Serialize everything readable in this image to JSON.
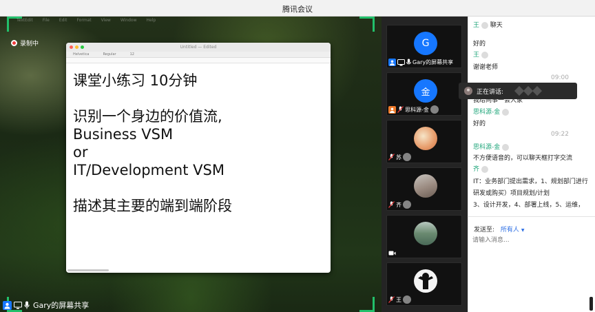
{
  "window": {
    "title": "腾讯会议"
  },
  "recording": {
    "label": "录制中"
  },
  "mac": {
    "menu": [
      "TextEdit",
      "File",
      "Edit",
      "Format",
      "View",
      "Window",
      "Help"
    ]
  },
  "editor": {
    "title": "Untitled — Edited",
    "font": "Helvetica",
    "style": "Regular",
    "size": "12",
    "lines": [
      "课堂小练习 10分钟",
      "",
      "识别一个身边的价值流,",
      "Business VSM",
      "or",
      "IT/Development VSM",
      "",
      "描述其主要的端到端阶段"
    ]
  },
  "share_bar": {
    "label": "Gary的屏幕共享"
  },
  "gallery": [
    {
      "avatar_letter": "G",
      "avatar_color": "#1677ff",
      "label": "Gary的屏幕共享"
    },
    {
      "avatar_letter": "金",
      "avatar_color": "#1677ff",
      "label": "思科源-金"
    },
    {
      "avatar_letter": "",
      "avatar_color": "#e8a070",
      "label": "苏"
    },
    {
      "avatar_letter": "",
      "avatar_color": "#9a8a80",
      "label": "齐"
    },
    {
      "avatar_letter": "",
      "avatar_color": "#6a8a70",
      "label": ""
    },
    {
      "avatar_letter": "",
      "avatar_color": "#f4f4f4",
      "label": "王"
    }
  ],
  "speaking": {
    "label": "正在讲话:"
  },
  "chat": {
    "header_sender": "王",
    "header_label": "聊天",
    "messages": [
      {
        "text": "好的"
      },
      {
        "sender": "王",
        "text": ""
      },
      {
        "text": "谢谢老师"
      },
      {
        "time": "09:00"
      },
      {
        "text": "我给同事一会大家"
      },
      {
        "sender": "思科源-金",
        "text": ""
      },
      {
        "text": "好的"
      },
      {
        "time": "09:22"
      },
      {
        "sender": "思科源-金",
        "text": ""
      },
      {
        "text": "不方便语音的，可以聊天框打字交流"
      },
      {
        "sender": "齐",
        "text": ""
      },
      {
        "text": "IT：业务部门提出需求，1、规划部门进行"
      },
      {
        "text": "研发或购买）项目规划/计划"
      },
      {
        "text": "3、设计开发，4、部署上线，5、运维，"
      }
    ],
    "send_to_label": "发送至:",
    "send_to_value": "所有人",
    "input_placeholder": "请输入消息..."
  },
  "colors": {
    "accent_green": "#22c06b",
    "chat_sender": "#1fa57a",
    "link_blue": "#2b6de4",
    "record_red": "#f03c3c"
  }
}
